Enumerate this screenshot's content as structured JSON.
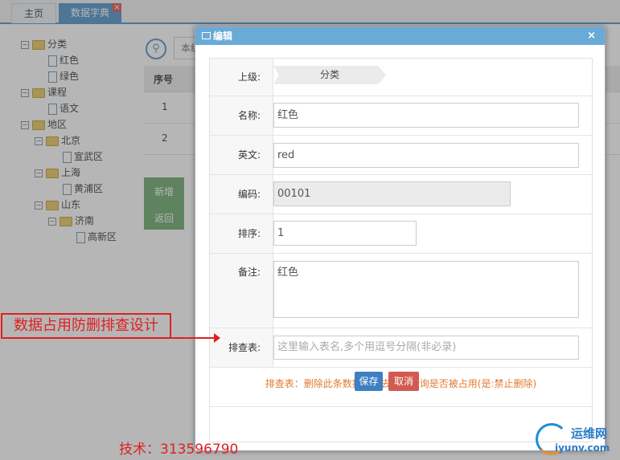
{
  "tabs": {
    "home": "主页",
    "dict": "数据字典",
    "dict_close": "×"
  },
  "tree": {
    "items": [
      {
        "label": "分类",
        "type": "folder",
        "toggle": "−"
      },
      {
        "label": "红色",
        "type": "file"
      },
      {
        "label": "绿色",
        "type": "file"
      },
      {
        "label": "课程",
        "type": "folder",
        "toggle": "−"
      },
      {
        "label": "语文",
        "type": "file"
      },
      {
        "label": "地区",
        "type": "folder",
        "toggle": "−"
      },
      {
        "label": "北京",
        "type": "folder",
        "toggle": "−"
      },
      {
        "label": "宣武区",
        "type": "file"
      },
      {
        "label": "上海",
        "type": "folder",
        "toggle": "−"
      },
      {
        "label": "黄浦区",
        "type": "file"
      },
      {
        "label": "山东",
        "type": "folder",
        "toggle": "−"
      },
      {
        "label": "济南",
        "type": "folder",
        "toggle": "−"
      },
      {
        "label": "高新区",
        "type": "file"
      }
    ]
  },
  "search": {
    "text": "本级"
  },
  "bg_table": {
    "header": "序号",
    "rows": [
      "1",
      "2"
    ]
  },
  "bg_buttons": {
    "add": "新增",
    "back": "返回"
  },
  "modal": {
    "title": "编辑",
    "close": "×",
    "fields": {
      "parent_label": "上级:",
      "parent_value": "分类",
      "name_label": "名称:",
      "name_value": "红色",
      "en_label": "英文:",
      "en_value": "red",
      "code_label": "编码:",
      "code_value": "00101",
      "order_label": "排序:",
      "order_value": "1",
      "remark_label": "备注:",
      "remark_value": "红色",
      "check_label": "排查表:",
      "check_placeholder": "这里输入表名,多个用逗号分隔(非必录)"
    },
    "note": "排查表：删除此条数据时会去此表查询是否被占用(是:禁止删除)",
    "save": "保存",
    "cancel": "取消"
  },
  "annotation": {
    "box_text": "数据占用防删排查设计",
    "contact": "技术：313596790"
  },
  "logo": {
    "name": "运维网",
    "url": "iyunv.com"
  }
}
